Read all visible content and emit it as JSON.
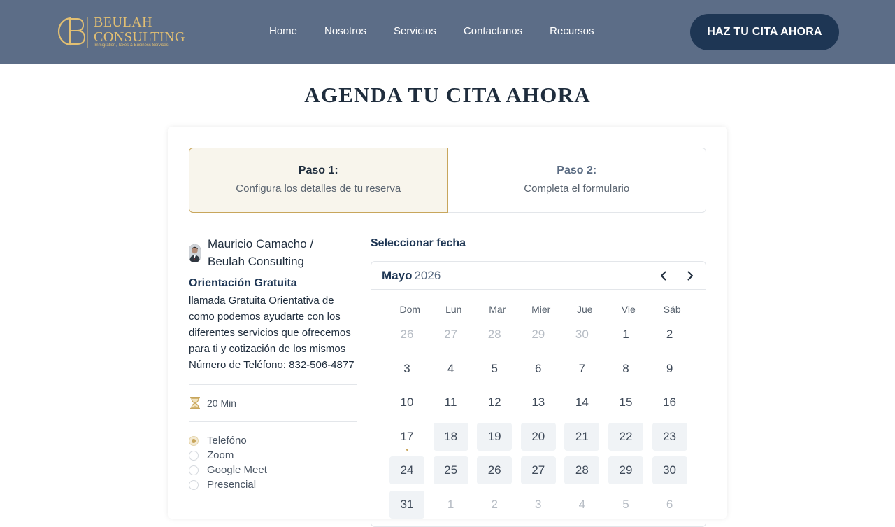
{
  "header": {
    "logo_name_line1": "BEULAH",
    "logo_name_line2": "CONSULTING",
    "logo_tagline": "Immigration, Taxes & Business Services",
    "nav": [
      "Home",
      "Nosotros",
      "Servicios",
      "Contactanos",
      "Recursos"
    ],
    "cta_label": "HAZ TU CITA AHORA"
  },
  "page_title": "AGENDA TU CITA AHORA",
  "steps": [
    {
      "title": "Paso 1:",
      "subtitle": "Configura los detalles de tu reserva"
    },
    {
      "title": "Paso 2:",
      "subtitle": "Completa el formulario"
    }
  ],
  "booking": {
    "host_line1": "Mauricio Camacho /",
    "host_line2": "Beulah Consulting",
    "service_title": "Orientación Gratuita",
    "service_description": "llamada Gratuita Orientativa de como podemos ayudarte con los diferentes servicios que ofrecemos para ti y cotización de los mismos Número de Teléfono: 832-506-4877",
    "duration": "20 Min",
    "locations": [
      {
        "label": "Telefóno",
        "selected": true
      },
      {
        "label": "Zoom",
        "selected": false
      },
      {
        "label": "Google Meet",
        "selected": false
      },
      {
        "label": "Presencial",
        "selected": false
      }
    ]
  },
  "calendar": {
    "heading": "Seleccionar fecha",
    "month": "Mayo",
    "year": "2026",
    "weekdays": [
      "Dom",
      "Lun",
      "Mar",
      "Mier",
      "Jue",
      "Vie",
      "Sáb"
    ],
    "weeks": [
      [
        {
          "d": "26",
          "s": "muted"
        },
        {
          "d": "27",
          "s": "muted"
        },
        {
          "d": "28",
          "s": "muted"
        },
        {
          "d": "29",
          "s": "muted"
        },
        {
          "d": "30",
          "s": "muted"
        },
        {
          "d": "1",
          "s": ""
        },
        {
          "d": "2",
          "s": ""
        }
      ],
      [
        {
          "d": "3",
          "s": ""
        },
        {
          "d": "4",
          "s": ""
        },
        {
          "d": "5",
          "s": ""
        },
        {
          "d": "6",
          "s": ""
        },
        {
          "d": "7",
          "s": ""
        },
        {
          "d": "8",
          "s": ""
        },
        {
          "d": "9",
          "s": ""
        }
      ],
      [
        {
          "d": "10",
          "s": ""
        },
        {
          "d": "11",
          "s": ""
        },
        {
          "d": "12",
          "s": ""
        },
        {
          "d": "13",
          "s": ""
        },
        {
          "d": "14",
          "s": ""
        },
        {
          "d": "15",
          "s": ""
        },
        {
          "d": "16",
          "s": ""
        }
      ],
      [
        {
          "d": "17",
          "s": "today"
        },
        {
          "d": "18",
          "s": "avail"
        },
        {
          "d": "19",
          "s": "avail"
        },
        {
          "d": "20",
          "s": "avail"
        },
        {
          "d": "21",
          "s": "avail"
        },
        {
          "d": "22",
          "s": "avail"
        },
        {
          "d": "23",
          "s": "avail"
        }
      ],
      [
        {
          "d": "24",
          "s": "avail"
        },
        {
          "d": "25",
          "s": "avail"
        },
        {
          "d": "26",
          "s": "avail"
        },
        {
          "d": "27",
          "s": "avail"
        },
        {
          "d": "28",
          "s": "avail"
        },
        {
          "d": "29",
          "s": "avail"
        },
        {
          "d": "30",
          "s": "avail"
        }
      ],
      [
        {
          "d": "31",
          "s": "avail"
        },
        {
          "d": "1",
          "s": "muted"
        },
        {
          "d": "2",
          "s": "muted"
        },
        {
          "d": "3",
          "s": "muted"
        },
        {
          "d": "4",
          "s": "muted"
        },
        {
          "d": "5",
          "s": "muted"
        },
        {
          "d": "6",
          "s": "muted"
        }
      ]
    ]
  },
  "colors": {
    "header_bg": "#5c6d87",
    "cta_bg": "#1e3654",
    "gold_accent": "#c8a65c"
  }
}
